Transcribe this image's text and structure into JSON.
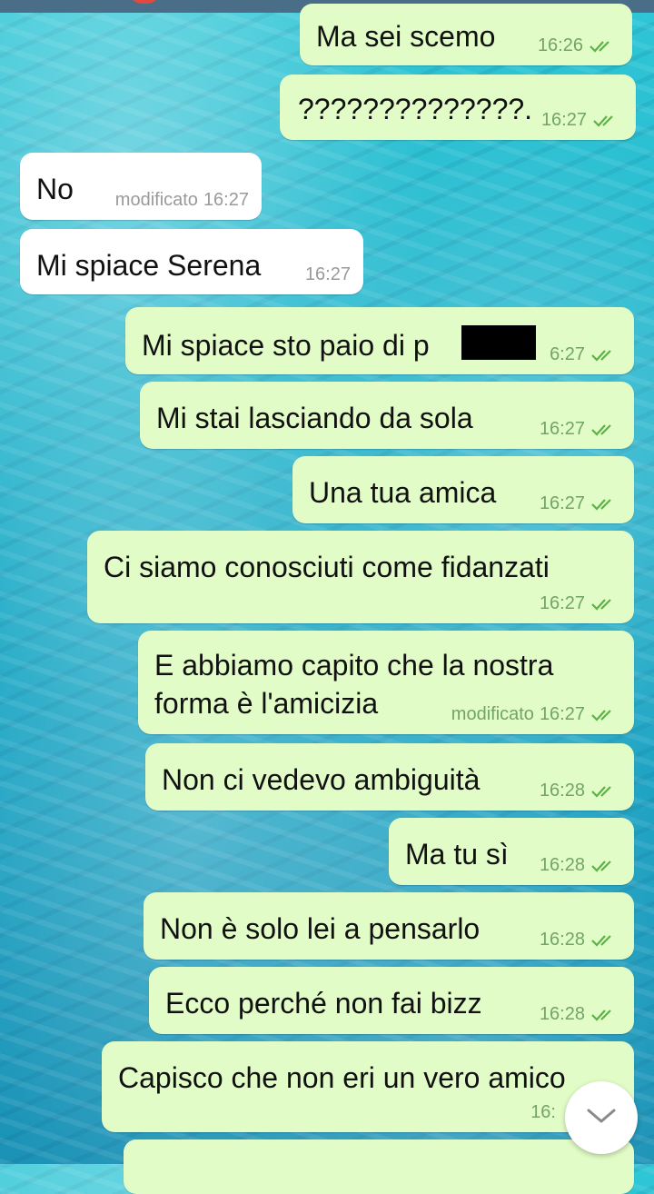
{
  "colors": {
    "outgoing_bubble": "#e2fcc7",
    "incoming_bubble": "#ffffff",
    "outgoing_meta": "#72a468",
    "incoming_meta": "#9a9a9a",
    "read_check": "#5fb04a"
  },
  "messages": [
    {
      "id": "m1",
      "direction": "out",
      "text": "Ma sei scemo",
      "time": "16:26",
      "status": "read"
    },
    {
      "id": "m2",
      "direction": "out",
      "text": "??????????????.",
      "time": "16:27",
      "status": "read"
    },
    {
      "id": "m3",
      "direction": "in",
      "text": "No",
      "edited_label": "modificato",
      "time": "16:27"
    },
    {
      "id": "m4",
      "direction": "in",
      "text": "Mi spiace Serena",
      "time": "16:27"
    },
    {
      "id": "m5",
      "direction": "out",
      "text": "Mi spiace sto paio di p",
      "time": "6:27",
      "status": "read",
      "redacted": true
    },
    {
      "id": "m6",
      "direction": "out",
      "text": "Mi stai lasciando da sola",
      "time": "16:27",
      "status": "read"
    },
    {
      "id": "m7",
      "direction": "out",
      "text": "Una tua amica",
      "time": "16:27",
      "status": "read"
    },
    {
      "id": "m8",
      "direction": "out",
      "text": "Ci siamo conosciuti come fidanzati",
      "time": "16:27",
      "status": "read"
    },
    {
      "id": "m9",
      "direction": "out",
      "text_line1": "E abbiamo capito che la nostra",
      "text_line2": "forma è l'amicizia",
      "edited_label": "modificato",
      "time": "16:27",
      "status": "read"
    },
    {
      "id": "m10",
      "direction": "out",
      "text": "Non ci vedevo ambiguità",
      "time": "16:28",
      "status": "read"
    },
    {
      "id": "m11",
      "direction": "out",
      "text": "Ma tu sì",
      "time": "16:28",
      "status": "read"
    },
    {
      "id": "m12",
      "direction": "out",
      "text": "Non è solo lei a pensarlo",
      "time": "16:28",
      "status": "read"
    },
    {
      "id": "m13",
      "direction": "out",
      "text": "Ecco perché non fai bizz",
      "time": "16:28",
      "status": "read"
    },
    {
      "id": "m14",
      "direction": "out",
      "text": "Capisco che non eri un vero amico",
      "time": "16:",
      "status": "read"
    }
  ],
  "scroll_button": {
    "icon": "chevron-down-icon"
  }
}
